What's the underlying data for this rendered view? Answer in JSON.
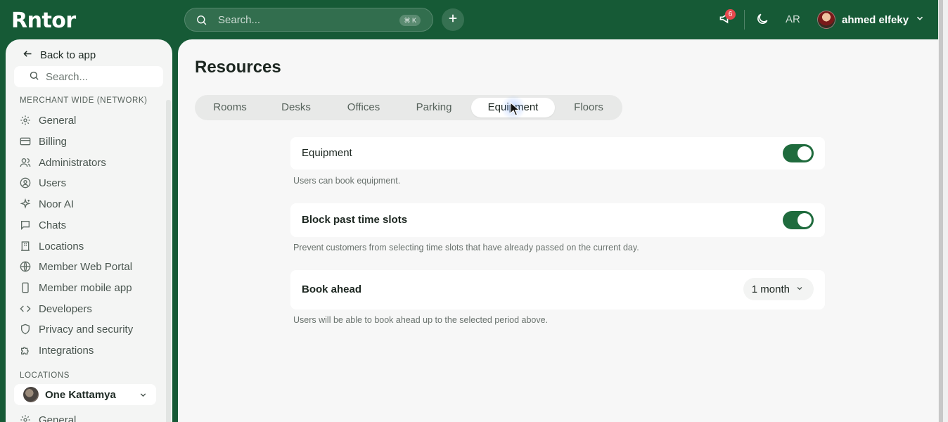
{
  "brand": {
    "logo_text": "Rntor"
  },
  "topbar": {
    "search_placeholder": "Search...",
    "search_shortcut": "⌘ K",
    "add_icon": "plus-icon",
    "notification_count": "6",
    "language": "AR",
    "user_name": "ahmed elfeky"
  },
  "sidebar": {
    "back_label": "Back to app",
    "search_placeholder": "Search...",
    "section_network": "MERCHANT WIDE (NETWORK)",
    "items": [
      {
        "label": "General",
        "icon": "gear-icon"
      },
      {
        "label": "Billing",
        "icon": "credit-card-icon"
      },
      {
        "label": "Administrators",
        "icon": "users-icon"
      },
      {
        "label": "Users",
        "icon": "user-circle-icon"
      },
      {
        "label": "Noor AI",
        "icon": "sparkle-icon"
      },
      {
        "label": "Chats",
        "icon": "chat-icon"
      },
      {
        "label": "Locations",
        "icon": "building-icon"
      },
      {
        "label": "Member Web Portal",
        "icon": "globe-icon"
      },
      {
        "label": "Member mobile app",
        "icon": "mobile-icon"
      },
      {
        "label": "Developers",
        "icon": "code-icon"
      },
      {
        "label": "Privacy and security",
        "icon": "shield-icon"
      },
      {
        "label": "Integrations",
        "icon": "puzzle-icon"
      }
    ],
    "section_locations": "LOCATIONS",
    "location_selected": "One Kattamya",
    "location_sub_item": "General"
  },
  "main": {
    "title": "Resources",
    "tabs": [
      {
        "label": "Rooms"
      },
      {
        "label": "Desks"
      },
      {
        "label": "Offices"
      },
      {
        "label": "Parking"
      },
      {
        "label": "Equipment"
      },
      {
        "label": "Floors"
      }
    ],
    "active_tab": "Equipment",
    "settings": {
      "equipment": {
        "label": "Equipment",
        "enabled": true,
        "helper": "Users can book equipment."
      },
      "block_past": {
        "label": "Block past time slots",
        "enabled": true,
        "helper": "Prevent customers from selecting time slots that have already passed on the current day."
      },
      "book_ahead": {
        "label": "Book ahead",
        "value": "1 month",
        "helper": "Users will be able to book ahead up to the selected period above."
      }
    }
  },
  "colors": {
    "brand_green": "#165a36",
    "toggle_on": "#1f6b3d",
    "badge_red": "#e5484d"
  }
}
